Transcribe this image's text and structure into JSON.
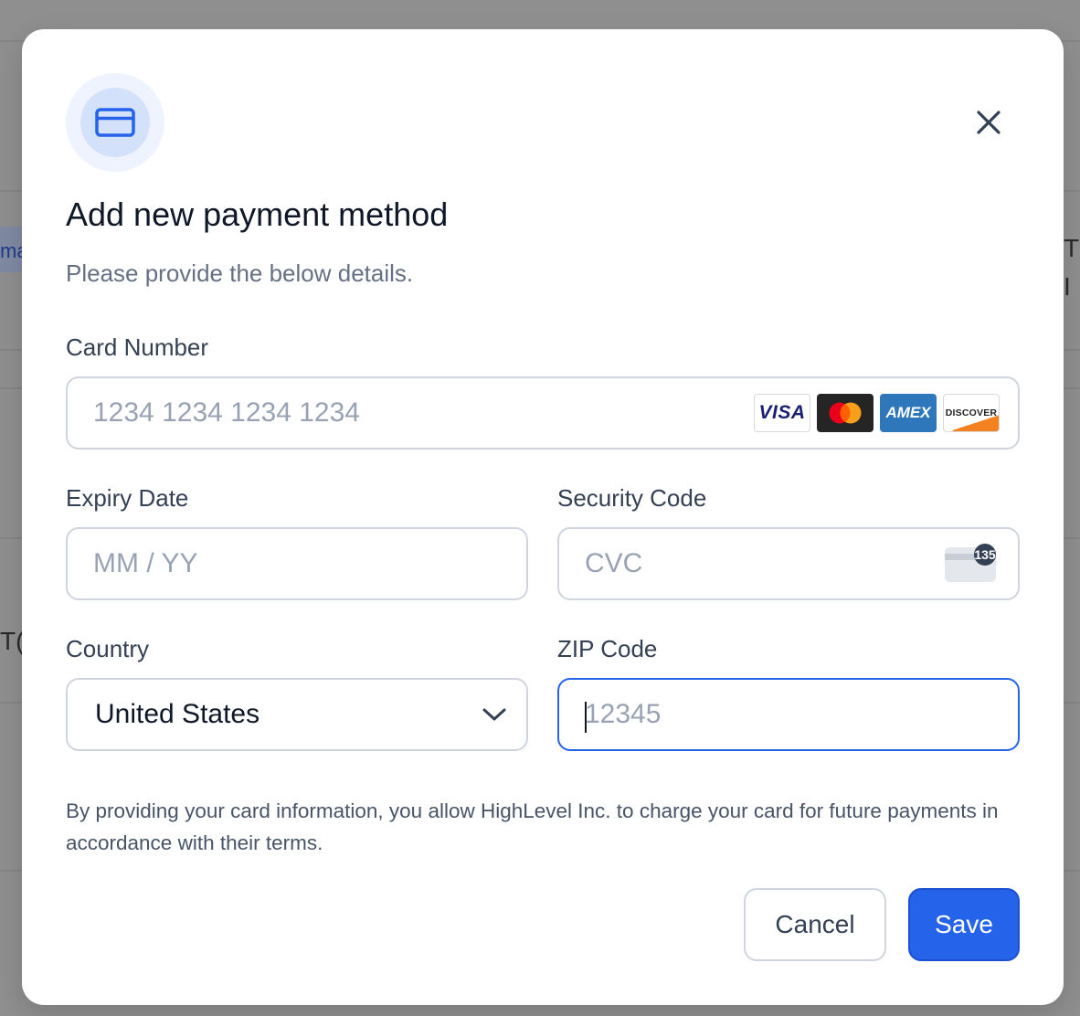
{
  "background": {
    "fragments": [
      "ma",
      "T",
      "I",
      "T("
    ]
  },
  "modal": {
    "title": "Add new payment method",
    "subtitle": "Please provide the below details.",
    "icon": "credit-card-icon",
    "close_icon": "close-icon"
  },
  "form": {
    "card_number": {
      "label": "Card Number",
      "placeholder": "1234 1234 1234 1234",
      "value": "",
      "brands": [
        "VISA",
        "Mastercard",
        "AMEX",
        "DISCOVER"
      ]
    },
    "expiry": {
      "label": "Expiry Date",
      "placeholder": "MM / YY",
      "value": ""
    },
    "security_code": {
      "label": "Security Code",
      "placeholder": "CVC",
      "value": "",
      "hint_number": "135"
    },
    "country": {
      "label": "Country",
      "value": "United States"
    },
    "zip": {
      "label": "ZIP Code",
      "placeholder": "12345",
      "value": "",
      "focused": true
    }
  },
  "notice": "By providing your card information, you allow HighLevel Inc. to charge your card for future payments in accordance with their terms.",
  "actions": {
    "cancel_label": "Cancel",
    "save_label": "Save"
  },
  "colors": {
    "primary": "#2563eb",
    "overlay": "#8f8f8f",
    "border": "#d0d5dd"
  }
}
